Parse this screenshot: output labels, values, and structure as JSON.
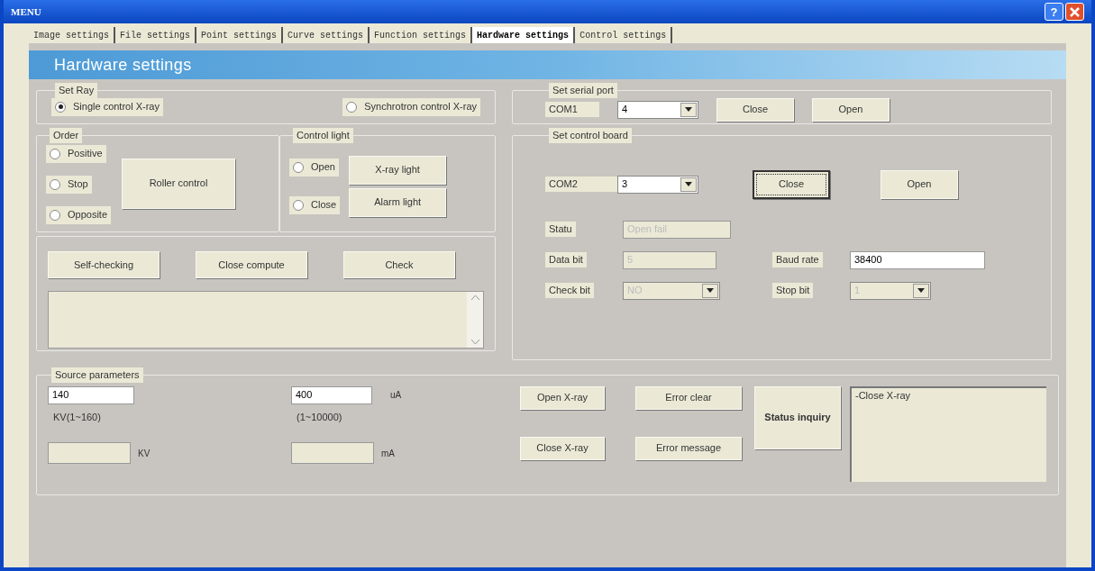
{
  "window": {
    "title": "MENU",
    "help": "?"
  },
  "tabs": [
    {
      "label": "Image settings",
      "selected": false
    },
    {
      "label": "File settings",
      "selected": false
    },
    {
      "label": "Point settings",
      "selected": false
    },
    {
      "label": "Curve settings",
      "selected": false
    },
    {
      "label": "Function settings",
      "selected": false
    },
    {
      "label": "Hardware settings",
      "selected": true
    },
    {
      "label": "Control settings",
      "selected": false
    }
  ],
  "banner": "Hardware settings",
  "set_ray": {
    "label": "Set Ray",
    "options": [
      {
        "label": "Single control X-ray",
        "selected": true
      },
      {
        "label": "Synchrotron control X-ray",
        "selected": false
      }
    ]
  },
  "order": {
    "label": "Order",
    "options": [
      {
        "label": "Positive",
        "selected": false
      },
      {
        "label": "Stop",
        "selected": false
      },
      {
        "label": "Opposite",
        "selected": false
      }
    ],
    "button": "Roller control"
  },
  "control_light": {
    "label": "Control light",
    "options": [
      {
        "label": "Open",
        "selected": false
      },
      {
        "label": "Close",
        "selected": false
      }
    ],
    "buttons": [
      "X-ray light",
      "Alarm light"
    ]
  },
  "checks": {
    "buttons": [
      "Self-checking",
      "Close compute",
      "Check"
    ]
  },
  "serial_port": {
    "label": "Set serial port",
    "port_label": "COM1",
    "port_value": "4",
    "buttons": [
      {
        "label": "Close",
        "focused": false
      },
      {
        "label": "Open",
        "focused": false
      }
    ]
  },
  "control_board": {
    "label": "Set control board",
    "port_label": "COM2",
    "port_value": "3",
    "buttons": [
      {
        "label": "Close",
        "focused": true
      },
      {
        "label": "Open",
        "focused": false
      }
    ],
    "fields": [
      {
        "label": "Statu",
        "value": "Open fail",
        "kind": "text",
        "disabled": true
      },
      {
        "label": "Data bit",
        "value": "5",
        "kind": "text",
        "disabled": true
      },
      {
        "label": "Baud rate",
        "value": "38400",
        "kind": "text",
        "disabled": false
      },
      {
        "label": "Check bit",
        "value": "NO",
        "kind": "select",
        "disabled": true
      },
      {
        "label": "Stop bit",
        "value": "1",
        "kind": "select",
        "disabled": true
      }
    ]
  },
  "source": {
    "label": "Source parameters",
    "kv_value": "140",
    "kv_range": "KV(1~160)",
    "kv_unit": "KV",
    "ua_value": "400",
    "ua_unit": "uA",
    "ua_range": "(1~10000)",
    "ma_unit": "mA",
    "buttons": [
      "Open X-ray",
      "Error clear",
      "Close X-ray",
      "Error message"
    ],
    "inquiry": "Status inquiry",
    "log": [
      "-Close X-ray"
    ]
  }
}
